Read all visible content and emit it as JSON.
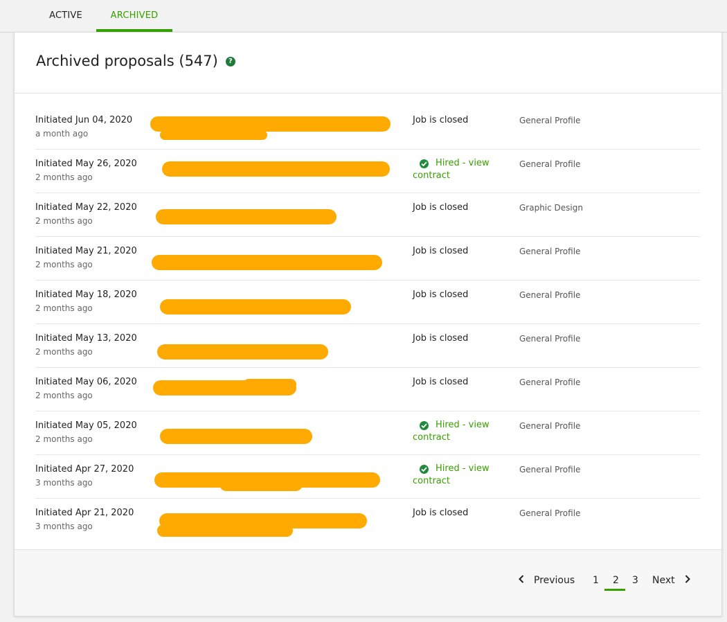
{
  "tabs": {
    "active_label": "ACTIVE",
    "archived_label": "ARCHIVED"
  },
  "header": {
    "title": "Archived proposals (547)",
    "help_icon": "question-circle-icon"
  },
  "proposals": [
    {
      "date": "Initiated Jun 04, 2020",
      "ago": "a month ago",
      "status": "Job is closed",
      "hired": false,
      "profile": "General Profile"
    },
    {
      "date": "Initiated May 26, 2020",
      "ago": "2 months ago",
      "status": "",
      "hired": true,
      "hired_line1": "Hired - view",
      "hired_line2": "contract",
      "profile": "General Profile"
    },
    {
      "date": "Initiated May 22, 2020",
      "ago": "2 months ago",
      "status": "Job is closed",
      "hired": false,
      "profile": "Graphic Design"
    },
    {
      "date": "Initiated May 21, 2020",
      "ago": "2 months ago",
      "status": "Job is closed",
      "hired": false,
      "profile": "General Profile"
    },
    {
      "date": "Initiated May 18, 2020",
      "ago": "2 months ago",
      "status": "Job is closed",
      "hired": false,
      "profile": "General Profile"
    },
    {
      "date": "Initiated May 13, 2020",
      "ago": "2 months ago",
      "status": "Job is closed",
      "hired": false,
      "profile": "General Profile"
    },
    {
      "date": "Initiated May 06, 2020",
      "ago": "2 months ago",
      "status": "Job is closed",
      "hired": false,
      "profile": "General Profile"
    },
    {
      "date": "Initiated May 05, 2020",
      "ago": "2 months ago",
      "status": "",
      "hired": true,
      "hired_line1": "Hired - view",
      "hired_line2": "contract",
      "profile": "General Profile"
    },
    {
      "date": "Initiated Apr 27, 2020",
      "ago": "3 months ago",
      "status": "",
      "hired": true,
      "hired_line1": "Hired - view",
      "hired_line2": "contract",
      "profile": "General Profile"
    },
    {
      "date": "Initiated Apr 21, 2020",
      "ago": "3 months ago",
      "status": "Job is closed",
      "hired": false,
      "profile": "General Profile"
    }
  ],
  "pagination": {
    "previous_label": "Previous",
    "next_label": "Next",
    "pages": [
      "1",
      "2",
      "3"
    ],
    "current_page": "2"
  },
  "colors": {
    "accent_green": "#37a000",
    "check_green": "#1f8a3c",
    "redaction_orange": "#ffaa00"
  }
}
